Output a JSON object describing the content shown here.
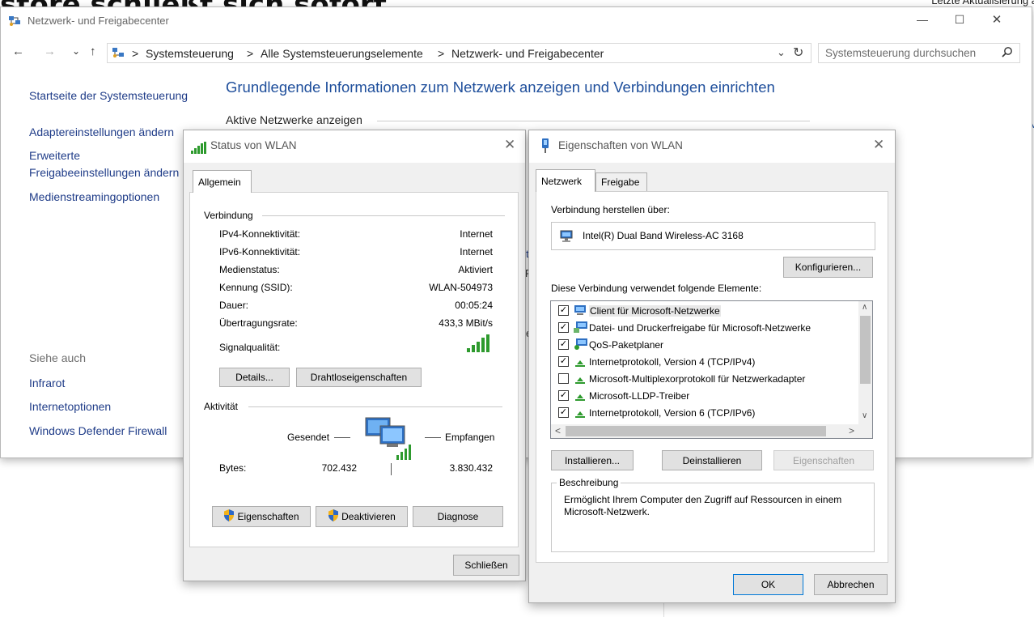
{
  "background": {
    "heading_fragment": "store schließt sich sofort..",
    "corner_fragment": "Letzte Aktualisierung a",
    "edge_fragment": "M"
  },
  "main_window": {
    "title": "Netzwerk- und Freigabecenter",
    "controls": {
      "minimize": "—",
      "maximize": "☐",
      "close": "✕"
    },
    "nav": {
      "back": "←",
      "forward": "→",
      "recent": "⌄",
      "up": "↑"
    },
    "breadcrumb": [
      "Systemsteuerung",
      "Alle Systemsteuerungselemente",
      "Netzwerk- und Freigabecenter"
    ],
    "separator": ">",
    "search_placeholder": "Systemsteuerung durchsuchen",
    "sidebar": {
      "home": "Startseite der Systemsteuerung",
      "adapter": "Adaptereinstellungen ändern",
      "advanced_1": "Erweiterte",
      "advanced_2": "Freigabeeinstellungen ändern",
      "media": "Medienstreamingoptionen",
      "see_also": "Siehe auch",
      "infrared": "Infrarot",
      "internet_options": "Internetoptionen",
      "firewall": "Windows Defender Firewall"
    },
    "heading": "Grundlegende Informationen zum Netzwerk anzeigen und Verbindungen einrichten",
    "active_networks": "Aktive Netzwerke anzeigen",
    "fragments": {
      "t": "t",
      "r": "R",
      "e": "e"
    }
  },
  "status_dialog": {
    "title": "Status von WLAN",
    "tab": "Allgemein",
    "connection_group": "Verbindung",
    "rows": [
      {
        "label": "IPv4-Konnektivität:",
        "value": "Internet"
      },
      {
        "label": "IPv6-Konnektivität:",
        "value": "Internet"
      },
      {
        "label": "Medienstatus:",
        "value": "Aktiviert"
      },
      {
        "label": "Kennung (SSID):",
        "value": "WLAN-504973"
      },
      {
        "label": "Dauer:",
        "value": "00:05:24"
      },
      {
        "label": "Übertragungsrate:",
        "value": "433,3 MBit/s"
      }
    ],
    "signal_label": "Signalqualität:",
    "signal_bars": 5,
    "details_button": "Details...",
    "wireless_button": "Drahtloseigenschaften",
    "activity_group": "Aktivität",
    "sent_label": "Gesendet",
    "received_label": "Empfangen",
    "bytes_label": "Bytes:",
    "bytes_sent": "702.432",
    "bytes_received": "3.830.432",
    "properties_button": "Eigenschaften",
    "disable_button": "Deaktivieren",
    "diagnose_button": "Diagnose",
    "close_button": "Schließen"
  },
  "props_dialog": {
    "title": "Eigenschaften von WLAN",
    "tab_network": "Netzwerk",
    "tab_sharing": "Freigabe",
    "connect_using_label": "Verbindung herstellen über:",
    "adapter_name": "Intel(R) Dual Band Wireless-AC 3168",
    "configure_button": "Konfigurieren...",
    "items_label": "Diese Verbindung verwendet folgende Elemente:",
    "items": [
      {
        "label": "Client für Microsoft-Netzwerke",
        "checked": true,
        "icon": "network-client-icon"
      },
      {
        "label": "Datei- und Druckerfreigabe für Microsoft-Netzwerke",
        "checked": true,
        "icon": "file-sharing-icon"
      },
      {
        "label": "QoS-Paketplaner",
        "checked": true,
        "icon": "qos-icon"
      },
      {
        "label": "Internetprotokoll, Version 4 (TCP/IPv4)",
        "checked": true,
        "icon": "protocol-icon"
      },
      {
        "label": "Microsoft-Multiplexorprotokoll für Netzwerkadapter",
        "checked": false,
        "icon": "protocol-icon"
      },
      {
        "label": "Microsoft-LLDP-Treiber",
        "checked": true,
        "icon": "protocol-icon"
      },
      {
        "label": "Internetprotokoll, Version 6 (TCP/IPv6)",
        "checked": true,
        "icon": "protocol-icon"
      }
    ],
    "install_button": "Installieren...",
    "uninstall_button": "Deinstallieren",
    "properties_button": "Eigenschaften",
    "description_group": "Beschreibung",
    "description_text": "Ermöglicht Ihrem Computer den Zugriff auf Ressourcen in einem Microsoft-Netzwerk.",
    "ok_button": "OK",
    "cancel_button": "Abbrechen"
  },
  "colors": {
    "link": "#1f3c88",
    "heading": "#1e4e9b",
    "signal": "#2e9a2e",
    "dialog_bg": "#f0f0f0",
    "accent": "#0078d7"
  }
}
